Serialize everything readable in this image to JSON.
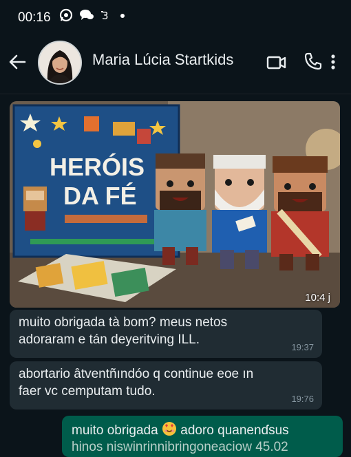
{
  "status_bar": {
    "time": "00:16",
    "icons": [
      "whatsapp-icon",
      "chat-bubbles-icon",
      "signal-icon",
      "dot-icon"
    ]
  },
  "header": {
    "contact_name": "Maria Lúcia Startkids",
    "actions": [
      "back-arrow-icon",
      "video-call-icon",
      "phone-call-icon",
      "more-vertical-icon"
    ]
  },
  "messages": [
    {
      "type": "image",
      "direction": "incoming",
      "time": "10:4 j",
      "image_text": {
        "title_line1": "HERÓIS",
        "title_line2": "DA FÉ"
      }
    },
    {
      "type": "text",
      "direction": "incoming",
      "line1": "muito obrigada tà bom? meus netos",
      "line2": "adoraram e tán deyeritving ILL.",
      "time": "19:37"
    },
    {
      "type": "text",
      "direction": "incoming",
      "line1": "abortario âtventñındóo q continue eoe ın",
      "line2": "faer vc cemputam tudo.",
      "time": "19:76"
    },
    {
      "type": "text",
      "direction": "outgoing",
      "line1_before": "muito obrigada",
      "line1_after": "adoro quanenɗsus",
      "line2": "hinos niswinrinnibringoneaciow 45.02"
    }
  ],
  "colors": {
    "background": "#0b141a",
    "incoming_bubble": "#202c33",
    "outgoing_bubble": "#005c4b",
    "text": "#e9edef",
    "meta": "#8696a0"
  }
}
